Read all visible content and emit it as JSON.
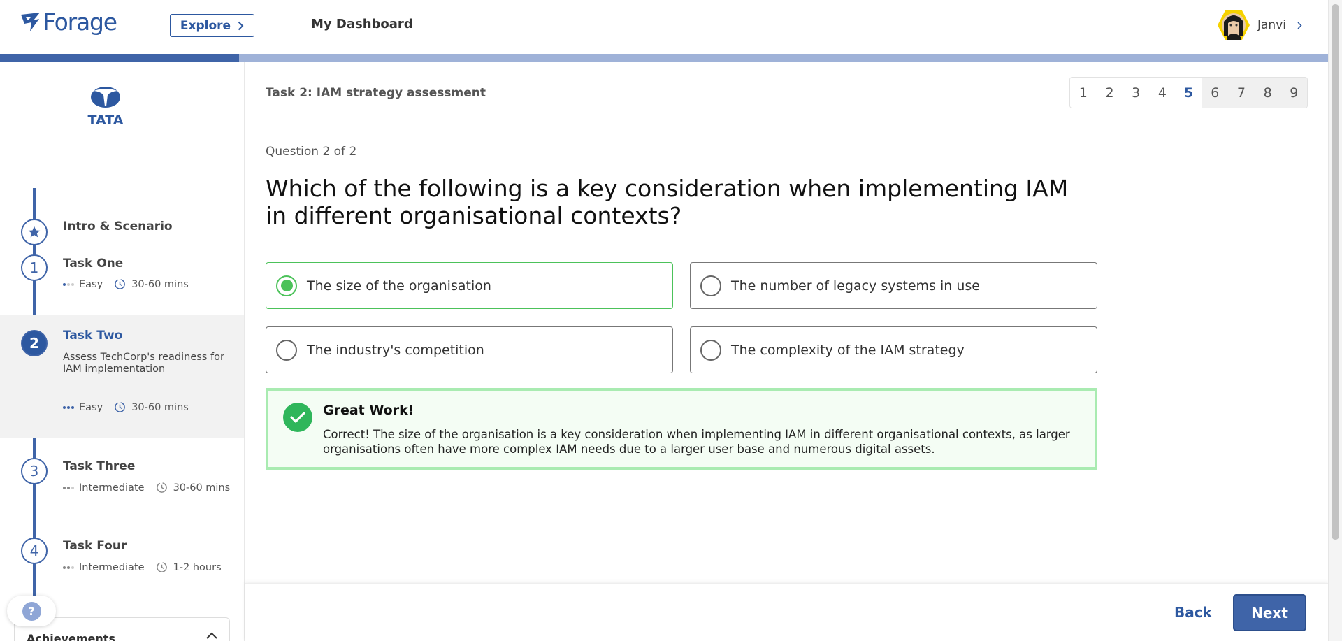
{
  "header": {
    "brand": "Forage",
    "explore_label": "Explore",
    "dashboard_label": "My Dashboard",
    "user_name": "Janvi"
  },
  "progress": {
    "fraction": 0.18
  },
  "sidebar": {
    "sponsor_logo_text": "TATA",
    "steps": [
      {
        "number": "",
        "title": "Intro & Scenario"
      },
      {
        "number": "1",
        "title": "Task One",
        "difficulty": "Easy",
        "duration": "30-60 mins"
      },
      {
        "number": "2",
        "title": "Task Two",
        "description": "Assess TechCorp's readiness for IAM implementation",
        "difficulty": "Easy",
        "duration": "30-60 mins"
      },
      {
        "number": "3",
        "title": "Task Three",
        "difficulty": "Intermediate",
        "duration": "30-60 mins"
      },
      {
        "number": "4",
        "title": "Task Four",
        "difficulty": "Intermediate",
        "duration": "1-2 hours"
      }
    ],
    "help_label": "?",
    "achievements_label": "Achievements"
  },
  "main": {
    "task_title": "Task 2: IAM strategy assessment",
    "pages": [
      "1",
      "2",
      "3",
      "4",
      "5",
      "6",
      "7",
      "8",
      "9"
    ],
    "current_page": "5",
    "question_count": "Question 2 of 2",
    "question": "Which of the following is a key consideration when implementing IAM in different organisational contexts?",
    "options": [
      {
        "label": "The size of the organisation",
        "selected": true
      },
      {
        "label": "The number of legacy systems in use",
        "selected": false
      },
      {
        "label": "The industry's competition",
        "selected": false
      },
      {
        "label": "The complexity of the IAM strategy",
        "selected": false
      }
    ],
    "feedback": {
      "title": "Great Work!",
      "body": "Correct! The size of the organisation is a key consideration when implementing IAM in different organisational contexts, as larger organisations often have more complex IAM needs due to a larger user base and numerous digital assets."
    }
  },
  "footer": {
    "back_label": "Back",
    "next_label": "Next"
  },
  "colors": {
    "brand": "#2d58a0",
    "accent": "#3f64a8",
    "success": "#4cc25a",
    "success_bg": "#f4fdf4"
  }
}
